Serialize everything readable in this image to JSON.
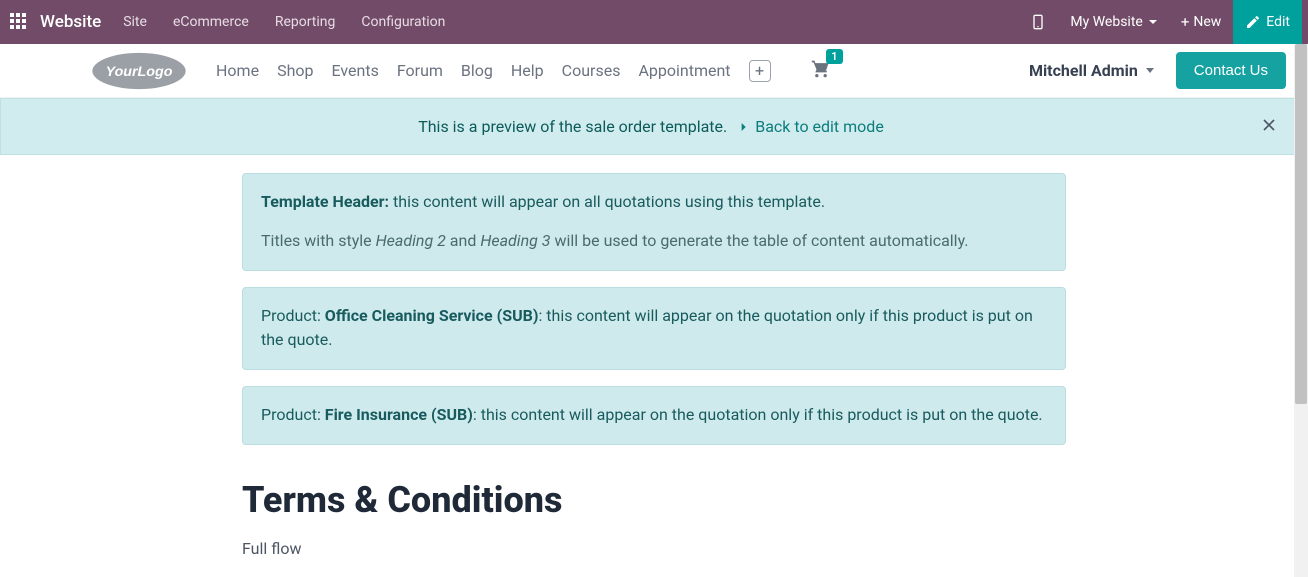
{
  "topbar": {
    "brand": "Website",
    "menu": [
      "Site",
      "eCommerce",
      "Reporting",
      "Configuration"
    ],
    "my_website": "My Website",
    "new": "New",
    "edit": "Edit"
  },
  "navbar": {
    "links": [
      "Home",
      "Shop",
      "Events",
      "Forum",
      "Blog",
      "Help",
      "Courses",
      "Appointment"
    ],
    "cart_count": "1",
    "user": "Mitchell Admin",
    "contact": "Contact Us"
  },
  "banner": {
    "text": "This is a preview of the sale order template.",
    "back": "Back to edit mode"
  },
  "boxes": {
    "header_label": "Template Header:",
    "header_text": " this content will appear on all quotations using this template.",
    "header_sub_pre": "Titles with style ",
    "h2": "Heading 2",
    "and": " and ",
    "h3": "Heading 3",
    "header_sub_post": " will be used to generate the table of content automatically.",
    "product_label": "Product: ",
    "product1": "Office Cleaning Service (SUB)",
    "product1_text": ": this content will appear on the quotation only if this product is put on the quote.",
    "product2": "Fire Insurance (SUB)",
    "product2_text": ": this content will appear on the quotation only if this product is put on the quote."
  },
  "terms": {
    "title": "Terms & Conditions",
    "body": "Full flow"
  }
}
